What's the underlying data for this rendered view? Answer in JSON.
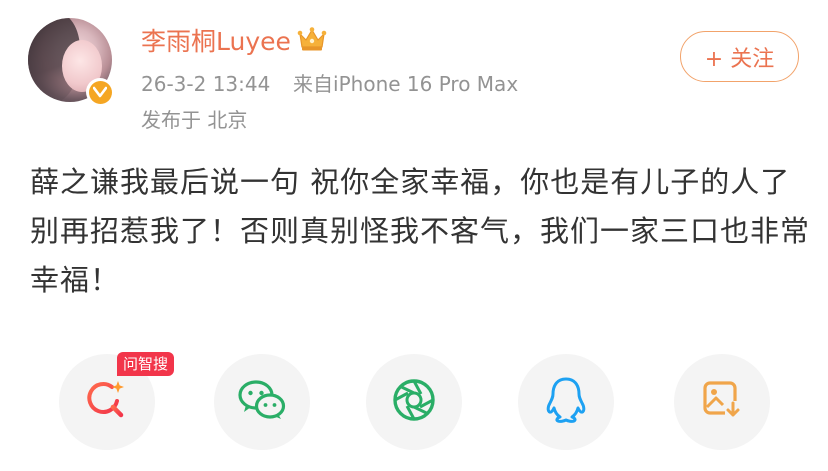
{
  "post": {
    "username": "李雨桐Luyee",
    "timestamp": "26-3-2 13:44",
    "source": "来自iPhone 16 Pro Max",
    "location": "发布于 北京",
    "follow_label": "+ 关注",
    "text": "薛之谦我最后说一句 祝你全家幸福，你也是有儿子的人了别再招惹我了！否则真别怪我不客气，我们一家三口也非常幸福！"
  },
  "share": {
    "ai_search_tag": "问智搜",
    "icons": [
      "ai-search-icon",
      "wechat-icon",
      "moments-icon",
      "qq-icon",
      "save-image-icon"
    ]
  },
  "colors": {
    "username": "#eb7350",
    "follow_border": "#f2a36b",
    "meta_text": "#939393",
    "body_text": "#333333",
    "tag_bg": "#f2354a",
    "wechat_green": "#2aae67",
    "qq_blue": "#1da1f2",
    "save_orange": "#f0a54a"
  }
}
